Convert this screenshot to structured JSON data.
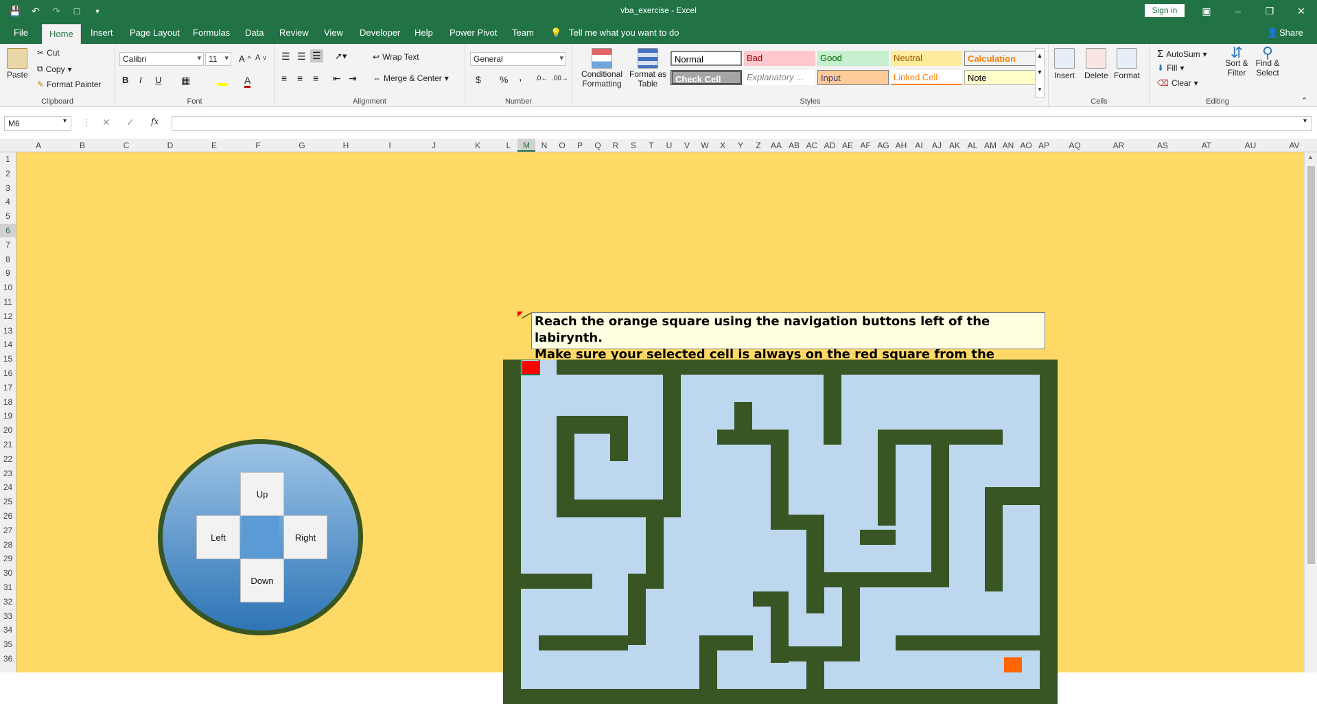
{
  "window": {
    "title": "vba_exercise  -  Excel",
    "sign_in": "Sign in",
    "share": "Share",
    "tell_me": "Tell me what you want to do"
  },
  "menu": {
    "tabs": [
      "File",
      "Home",
      "Insert",
      "Page Layout",
      "Formulas",
      "Data",
      "Review",
      "View",
      "Developer",
      "Help",
      "Power Pivot",
      "Team"
    ],
    "active": "Home"
  },
  "ribbon": {
    "clipboard": {
      "paste": "Paste",
      "cut": "Cut",
      "copy": "Copy",
      "format_painter": "Format Painter",
      "label": "Clipboard"
    },
    "font": {
      "name": "Calibri",
      "size": "11",
      "label": "Font",
      "bold": "B",
      "italic": "I",
      "underline": "U"
    },
    "alignment": {
      "wrap_text": "Wrap Text",
      "merge_center": "Merge & Center",
      "label": "Alignment"
    },
    "number": {
      "format": "General",
      "label": "Number",
      "currency": "$",
      "percent": "%",
      "comma": ","
    },
    "styles": {
      "conditional_formatting": "Conditional Formatting",
      "format_as_table": "Format as Table",
      "label": "Styles",
      "cells": [
        {
          "name": "Normal",
          "bg": "#ffffff",
          "fg": "#000000"
        },
        {
          "name": "Bad",
          "bg": "#ffc7ce",
          "fg": "#9c0006"
        },
        {
          "name": "Good",
          "bg": "#c6efce",
          "fg": "#006100"
        },
        {
          "name": "Neutral",
          "bg": "#ffeb9c",
          "fg": "#9c5700"
        },
        {
          "name": "Calculation",
          "bg": "#f2f2f2",
          "fg": "#fa7d00"
        },
        {
          "name": "Check Cell",
          "bg": "#a5a5a5",
          "fg": "#ffffff"
        },
        {
          "name": "Explanatory ...",
          "bg": "#ffffff",
          "fg": "#7f7f7f"
        },
        {
          "name": "Input",
          "bg": "#ffcc99",
          "fg": "#3f3f76"
        },
        {
          "name": "Linked Cell",
          "bg": "#ffffff",
          "fg": "#fa7d00"
        },
        {
          "name": "Note",
          "bg": "#ffffcc",
          "fg": "#000000"
        }
      ]
    },
    "cells": {
      "insert": "Insert",
      "delete": "Delete",
      "format": "Format",
      "label": "Cells"
    },
    "editing": {
      "autosum": "AutoSum",
      "fill": "Fill",
      "clear": "Clear",
      "sort_filter": "Sort & Filter",
      "find_select": "Find & Select",
      "label": "Editing"
    }
  },
  "formula_bar": {
    "name_box": "M6",
    "fx": "fx",
    "formula": ""
  },
  "grid": {
    "columns": [
      "A",
      "B",
      "C",
      "D",
      "E",
      "F",
      "G",
      "H",
      "I",
      "J",
      "K",
      "L",
      "M",
      "N",
      "O",
      "P",
      "Q",
      "R",
      "S",
      "T",
      "U",
      "V",
      "W",
      "X",
      "Y",
      "Z",
      "AA",
      "AB",
      "AC",
      "AD",
      "AE",
      "AF",
      "AG",
      "AH",
      "AI",
      "AJ",
      "AK",
      "AL",
      "AM",
      "AN",
      "AO",
      "AP",
      "AQ",
      "AR",
      "AS",
      "AT",
      "AU",
      "AV"
    ],
    "rows": [
      "1",
      "2",
      "3",
      "4",
      "5",
      "6",
      "7",
      "8",
      "9",
      "10",
      "11",
      "12",
      "13",
      "14",
      "15",
      "16",
      "17",
      "18",
      "19",
      "20",
      "21",
      "22",
      "23",
      "24",
      "25",
      "26",
      "27",
      "28",
      "29",
      "30",
      "31",
      "32",
      "33",
      "34",
      "35",
      "36"
    ],
    "selected_column": "M",
    "selected_row": "6"
  },
  "navigation": {
    "up": "Up",
    "left": "Left",
    "right": "Right",
    "down": "Down"
  },
  "instruction": {
    "line1": "Reach the orange square using the navigation buttons left of the labirynth.",
    "line2": "Make sure your selected cell is always on the red square from the beginnig!"
  },
  "colors": {
    "excel_green": "#217346",
    "sheet_bg": "#ffd966",
    "maze_wall": "#375623",
    "maze_path": "#bdd7ee",
    "start": "#ff0000",
    "goal": "#ff6600"
  }
}
